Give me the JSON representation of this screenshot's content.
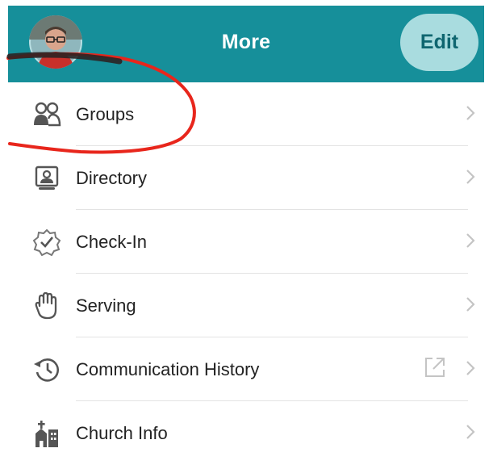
{
  "header": {
    "title": "More",
    "edit_label": "Edit",
    "background_color": "#168f9a"
  },
  "menu": {
    "items": [
      {
        "label": "Groups",
        "icon": "groups-icon"
      },
      {
        "label": "Directory",
        "icon": "directory-icon"
      },
      {
        "label": "Check-In",
        "icon": "check-in-icon"
      },
      {
        "label": "Serving",
        "icon": "hand-icon"
      },
      {
        "label": "Communication History",
        "icon": "history-icon",
        "external": true
      },
      {
        "label": "Church Info",
        "icon": "church-icon"
      }
    ]
  },
  "annotation": {
    "color": "#e8261c",
    "shape": "hand-drawn circle around Groups"
  }
}
